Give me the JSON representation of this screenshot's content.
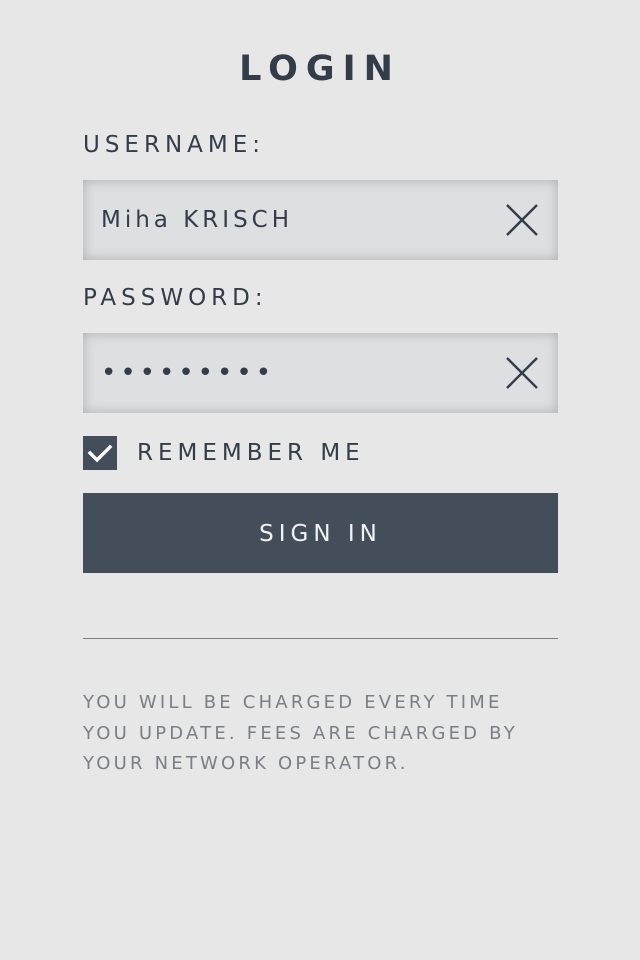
{
  "title": "LOGIN",
  "username": {
    "label": "USERNAME:",
    "value": "Miha KRISCH"
  },
  "password": {
    "label": "PASSWORD:",
    "masked_value": "•••••••••"
  },
  "remember": {
    "label": "REMEMBER ME",
    "checked": true
  },
  "sign_in_label": "SIGN IN",
  "disclaimer": {
    "line1": "YOU WILL BE CHARGED EVERY TIME",
    "line2": "YOU UPDATE. FEES ARE CHARGED BY",
    "line3": "YOUR NETWORK OPERATOR."
  },
  "colors": {
    "background": "#e7e7e7",
    "text": "#333d4a",
    "button": "#444e5a",
    "muted": "#7a7f86"
  },
  "icons": {
    "clear": "close-icon",
    "check": "checkmark-icon"
  }
}
